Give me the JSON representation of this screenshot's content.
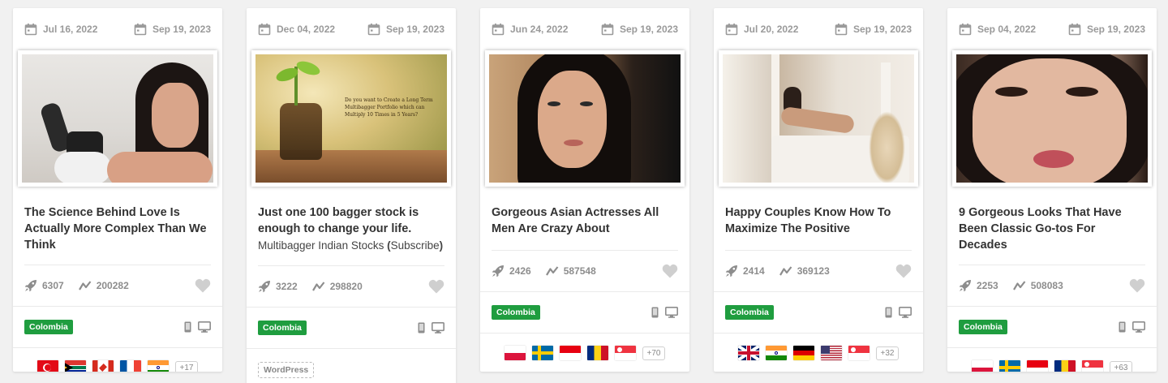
{
  "cards": [
    {
      "created": "Jul 16, 2022",
      "updated": "Sep 19, 2023",
      "title": "The Science Behind Love Is Actually More Complex Than We Think",
      "launches": "6307",
      "trend": "200282",
      "country": "Colombia",
      "flags": [
        "turkey",
        "south-africa",
        "canada",
        "france",
        "india"
      ],
      "more_flags": "+17"
    },
    {
      "created": "Dec 04, 2022",
      "updated": "Sep 19, 2023",
      "title": "Just one 100 bagger stock is enough to change your life.",
      "subtitle": "Multibagger Indian Stocks",
      "subtitle_link": "Subscribe",
      "image_text": "Do you want to Create a Long Term Multibagger Portfolio which can Multiply 10 Times in 5 Years?",
      "launches": "3222",
      "trend": "298820",
      "country": "Colombia",
      "platform": "WordPress"
    },
    {
      "created": "Jun 24, 2022",
      "updated": "Sep 19, 2023",
      "title": "Gorgeous Asian Actresses All Men Are Crazy About",
      "launches": "2426",
      "trend": "587548",
      "country": "Colombia",
      "flags": [
        "poland",
        "sweden",
        "indonesia",
        "romania",
        "singapore"
      ],
      "more_flags": "+70"
    },
    {
      "created": "Jul 20, 2022",
      "updated": "Sep 19, 2023",
      "title": "Happy Couples Know How To Maximize The Positive",
      "launches": "2414",
      "trend": "369123",
      "country": "Colombia",
      "flags": [
        "uk",
        "india",
        "germany",
        "usa",
        "singapore"
      ],
      "more_flags": "+32"
    },
    {
      "created": "Sep 04, 2022",
      "updated": "Sep 19, 2023",
      "title": "9 Gorgeous Looks That Have Been Classic Go-tos For Decades",
      "launches": "2253",
      "trend": "508083",
      "country": "Colombia",
      "flags": [
        "poland",
        "sweden",
        "indonesia",
        "romania",
        "singapore"
      ],
      "more_flags": "+63"
    }
  ],
  "colors": {
    "accent_green": "#1f9d3f",
    "icon_gray": "#9a9a9a"
  }
}
